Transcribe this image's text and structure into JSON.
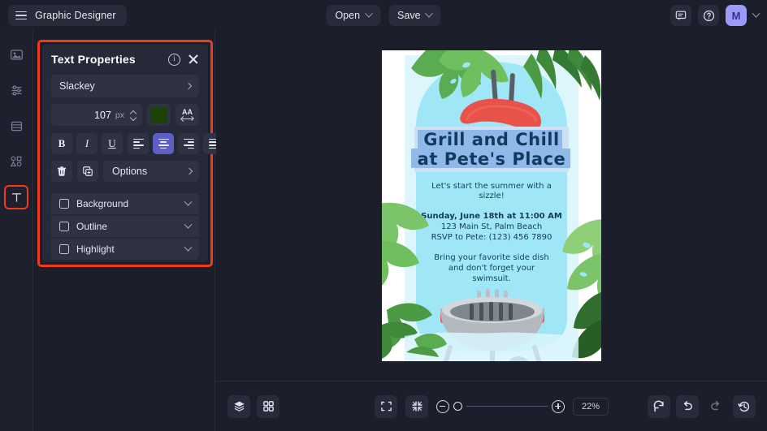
{
  "app": {
    "title": "Graphic Designer",
    "menu_icon": "hamburger-icon"
  },
  "topbar": {
    "open_label": "Open",
    "save_label": "Save",
    "comment_icon": "comment-icon",
    "help_icon": "help-circle-icon",
    "avatar_initial": "M"
  },
  "sidebar": {
    "items": [
      {
        "name": "sidebar-item-images",
        "icon": "image-icon",
        "selected": false
      },
      {
        "name": "sidebar-item-adjustments",
        "icon": "sliders-icon",
        "selected": false
      },
      {
        "name": "sidebar-item-templates",
        "icon": "layout-rows-icon",
        "selected": false
      },
      {
        "name": "sidebar-item-shapes",
        "icon": "shapes-icon",
        "selected": false
      },
      {
        "name": "sidebar-item-text",
        "icon": "text-t-icon",
        "selected": true
      }
    ]
  },
  "panel": {
    "title": "Text Properties",
    "info_icon": "info-icon",
    "close_icon": "close-icon",
    "font_family": "Slackey",
    "font_size": "107",
    "font_size_unit": "px",
    "color_swatch": "#1d4208",
    "letter_spacing_icon": "letter-spacing-icon",
    "bold_label": "B",
    "italic_label": "I",
    "underline_label": "U",
    "align_active": "center",
    "delete_icon": "trash-icon",
    "duplicate_icon": "duplicate-icon",
    "options_label": "Options",
    "accordions": [
      {
        "label": "Background",
        "checked": false
      },
      {
        "label": "Outline",
        "checked": false
      },
      {
        "label": "Highlight",
        "checked": false
      }
    ]
  },
  "canvas": {
    "poster": {
      "bg_color": "#ffffff",
      "body_color": "#a3e9f7",
      "heading_line1": "Grill and Chill",
      "heading_line2": "at Pete's Place",
      "heading_color": "#123a5e",
      "heading_highlight": "#8fb9e8",
      "subtitle_line1": "Let's start the summer with a",
      "subtitle_line2": "sizzle!",
      "details_line1": "Sunday, June 18th at 11:00 AM",
      "details_line2": "123 Main St, Palm Beach",
      "details_line3": "RSVP to Pete: (123) 456 7890",
      "note_line1": "Bring your favorite side dish",
      "note_line2": "and don't forget your",
      "note_line3": "swimsuit.",
      "grill_icon": "bbq-grill-illustration",
      "leaf_icon": "tropical-leaf-illustration"
    }
  },
  "bottombar": {
    "layers_icon": "layers-icon",
    "grid_icon": "grid-icon",
    "fit_icon": "fit-to-screen-icon",
    "shrink_icon": "shrink-icon",
    "zoom_out_icon": "zoom-out-icon",
    "zoom_in_icon": "zoom-in-icon",
    "zoom_level": "22%",
    "reset_icon": "reset-icon",
    "undo_icon": "undo-icon",
    "redo_icon": "redo-icon",
    "history_icon": "history-icon"
  }
}
